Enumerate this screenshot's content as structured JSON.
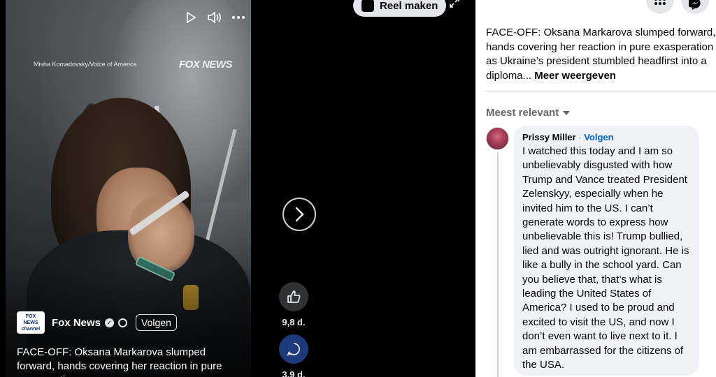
{
  "video": {
    "credit": "Misha Komadovsky/Voice of America",
    "watermark": "FOX NEWS",
    "channel": {
      "logo_text": "FOX NEWS channel",
      "name": "Fox News",
      "follow_label": "Volgen"
    },
    "caption": "FACE-OFF: Oksana Markarova slumped forward, hands covering her reaction in pure exasperation..."
  },
  "actions": {
    "like_count": "9,8 d.",
    "comment_count": "3,9 d."
  },
  "toolbar": {
    "reel_label": "Reel maken"
  },
  "post": {
    "text": "FACE-OFF: Oksana Markarova slumped forward, hands covering her reaction in pure exasperation as Ukraine’s president stumbled headfirst into a diploma...",
    "more_label": "Meer weergeven"
  },
  "comments": {
    "sort_label": "Meest relevant",
    "items": [
      {
        "author": "Prissy Miller",
        "separator": "·",
        "follow_label": "Volgen",
        "text": "I watched this today and I am so unbelievably disgusted with how Trump and Vance treated President Zelenskyy, especially when he invited him to the US. I can’t generate words to express how unbelievable this is! Trump bullied, lied and was outright ignorant. He is like a bully in the school yard. Can you believe that, that’s what is leading the United States of America? I used to be proud and excited to visit the US, and now I don’t even want to live next to it. I am embarrassed for the citizens of the USA."
      }
    ]
  },
  "icons": [
    "play-icon",
    "volume-icon",
    "more-icon",
    "verified-icon",
    "globe-icon",
    "next-icon",
    "like-icon",
    "comment-icon",
    "reel-icon",
    "expand-icon",
    "menu-grid-icon",
    "messenger-icon",
    "caret-down-icon"
  ]
}
